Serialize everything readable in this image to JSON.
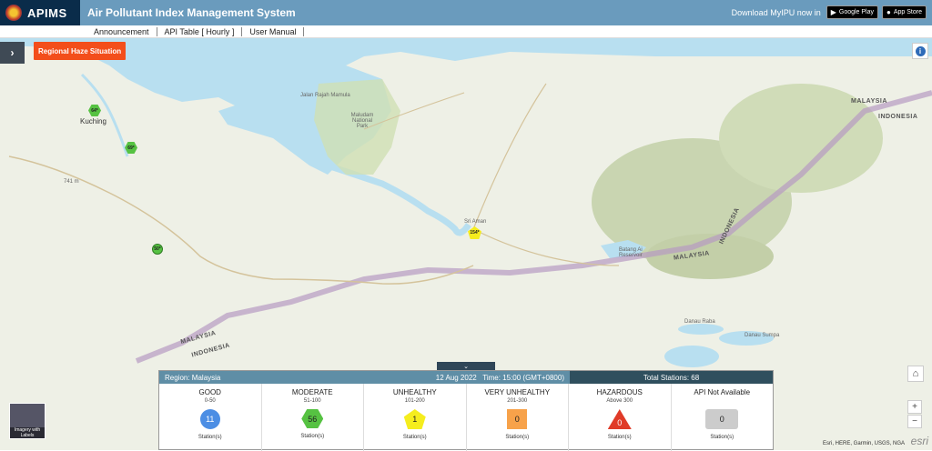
{
  "header": {
    "logo_text": "APIMS",
    "title": "Air Pollutant Index Management System",
    "download_text": "Download MyIPU now in",
    "google_play": "Google Play",
    "app_store": "App Store"
  },
  "nav": [
    "Announcement",
    "API Table [ Hourly ]",
    "User Manual"
  ],
  "map": {
    "haze_button": "Regional Haze Situation",
    "labels": {
      "kuching": "Kuching",
      "sri_aman": "Sri Aman",
      "maludam": "Maludam National Park",
      "malaysia_1": "MALAYSIA",
      "malaysia_2": "MALAYSIA",
      "malaysia_3": "MALAYSIA",
      "indonesia_1": "INDONESIA",
      "indonesia_2": "INDONESIA",
      "indonesia_3": "INDONESIA",
      "batang_ai": "Batang Ai Reservoir",
      "danau_raba": "Danau Raba",
      "danau_sumpa": "Danau Sumpa"
    },
    "markers": [
      {
        "value": "64*",
        "status": "moderate"
      },
      {
        "value": "69*",
        "status": "moderate"
      },
      {
        "value": "50*",
        "status": "good"
      },
      {
        "value": "154*",
        "status": "unhealthy"
      }
    ],
    "imagery_label": "Imagery with Labels",
    "attribution": "Esri, HERE, Garmin, USGS, NGA",
    "esri": "esri"
  },
  "panel": {
    "region": "Region: Malaysia",
    "datetime": "12 Aug 2022   Time: 15:00 (GMT+0800)",
    "total": "Total Stations: 68",
    "footer": "Station(s)",
    "categories": [
      {
        "title": "GOOD",
        "range": "0-50",
        "count": "11"
      },
      {
        "title": "MODERATE",
        "range": "51-100",
        "count": "56"
      },
      {
        "title": "UNHEALTHY",
        "range": "101-200",
        "count": "1"
      },
      {
        "title": "VERY UNHEALTHY",
        "range": "201-300",
        "count": "0"
      },
      {
        "title": "HAZARDOUS",
        "range": "Above 300",
        "count": "0"
      },
      {
        "title": "API Not Available",
        "range": "",
        "count": "0"
      }
    ]
  },
  "colors": {
    "good": "#4c8ee4",
    "moderate": "#56c242",
    "unhealthy": "#f5ed1e",
    "very_unhealthy": "#f7a24a",
    "hazardous": "#e03b28",
    "not_available": "#cccccc"
  },
  "icons": {
    "side_toggle": "chevron-right-icon",
    "bottom_toggle": "chevron-down-icon",
    "info": "info-icon",
    "home": "home-icon"
  }
}
